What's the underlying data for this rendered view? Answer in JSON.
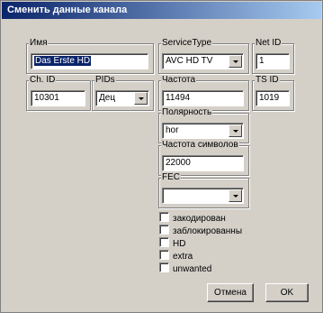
{
  "window": {
    "title": "Сменить данные канала"
  },
  "fields": {
    "name": {
      "label": "Имя",
      "value": "Das Erste HD"
    },
    "service_type": {
      "label": "ServiceType",
      "value": "AVC HD TV"
    },
    "net_id": {
      "label": "Net ID",
      "value": "1"
    },
    "ch_id": {
      "label": "Ch. ID",
      "value": "10301"
    },
    "pids": {
      "label": "PIDs",
      "value": "Дец"
    },
    "frequency": {
      "label": "Частота",
      "value": "11494"
    },
    "ts_id": {
      "label": "TS ID",
      "value": "1019"
    },
    "polarity": {
      "label": "Полярность",
      "value": "hor"
    },
    "symbol_rate": {
      "label": "Частота символов",
      "value": "22000"
    },
    "fec": {
      "label": "FEC",
      "value": ""
    }
  },
  "checkboxes": [
    {
      "label": "закодирован",
      "checked": false
    },
    {
      "label": "заблокированны",
      "checked": false
    },
    {
      "label": "HD",
      "checked": false
    },
    {
      "label": "extra",
      "checked": false
    },
    {
      "label": "unwanted",
      "checked": false
    }
  ],
  "buttons": {
    "cancel": "Отмена",
    "ok": "OK"
  }
}
